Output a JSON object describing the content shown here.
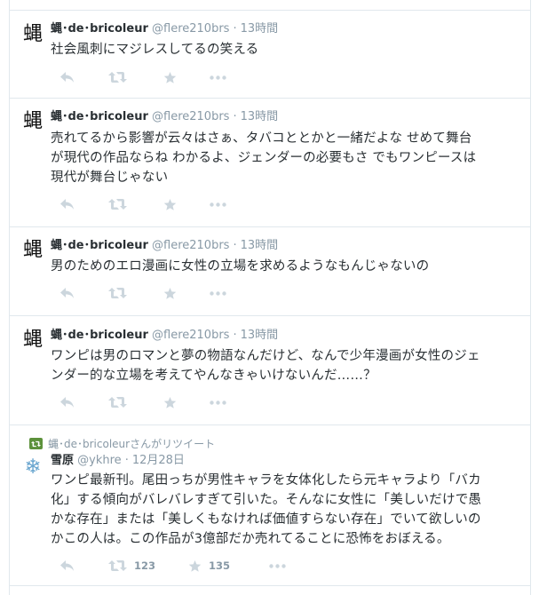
{
  "tweets": [
    {
      "avatar_glyph": "蝿",
      "name": "蝿･de･bricoleur",
      "handle": "@flere210brs",
      "time": "13時間",
      "text": "社会風刺にマジレスしてるの笑える"
    },
    {
      "avatar_glyph": "蝿",
      "name": "蝿･de･bricoleur",
      "handle": "@flere210brs",
      "time": "13時間",
      "lines": [
        "売れてるから影響が云々はさぁ、タバコととかと一緒だよな せめて舞台",
        "が現代の作品ならね わかるよ、ジェンダーの必要もさ でもワンピースは",
        "現代が舞台じゃない"
      ]
    },
    {
      "avatar_glyph": "蝿",
      "name": "蝿･de･bricoleur",
      "handle": "@flere210brs",
      "time": "13時間",
      "text": "男のためのエロ漫画に女性の立場を求めるようなもんじゃないの"
    },
    {
      "avatar_glyph": "蝿",
      "name": "蝿･de･bricoleur",
      "handle": "@flere210brs",
      "time": "13時間",
      "lines": [
        "ワンピは男のロマンと夢の物語なんだけど、なんで少年漫画が女性のジェ",
        "ンダー的な立場を考えてやんなきゃいけないんだ……？"
      ]
    },
    {
      "retweet_context": "蝿･de･bricoleurさんがリツイート",
      "avatar_glyph": "❄",
      "name": "雪原",
      "handle": "@ykhre",
      "time": "12月28日",
      "lines": [
        "ワンピ最新刊。尾田っちが男性キャラを女体化したら元キャラより「バカ",
        "化」する傾向がバレバレすぎて引いた。そんなに女性に「美しいだけで愚",
        "かな存在」または「美しくもなければ価値すらない存在」でいて欲しいの",
        "かこの人は。この作品が3億部だか売れてることに恐怖をおぼえる。"
      ],
      "retweet_count": "123",
      "favorite_count": "135"
    }
  ],
  "icons": {
    "reply": "reply-icon",
    "retweet": "retweet-icon",
    "favorite": "star-icon",
    "more": "more-icon"
  },
  "colors": {
    "action_icon": "#ccd6dd",
    "meta_text": "#8899a6",
    "retweet_green": "#5c913b",
    "divider": "#e1e8ed"
  }
}
